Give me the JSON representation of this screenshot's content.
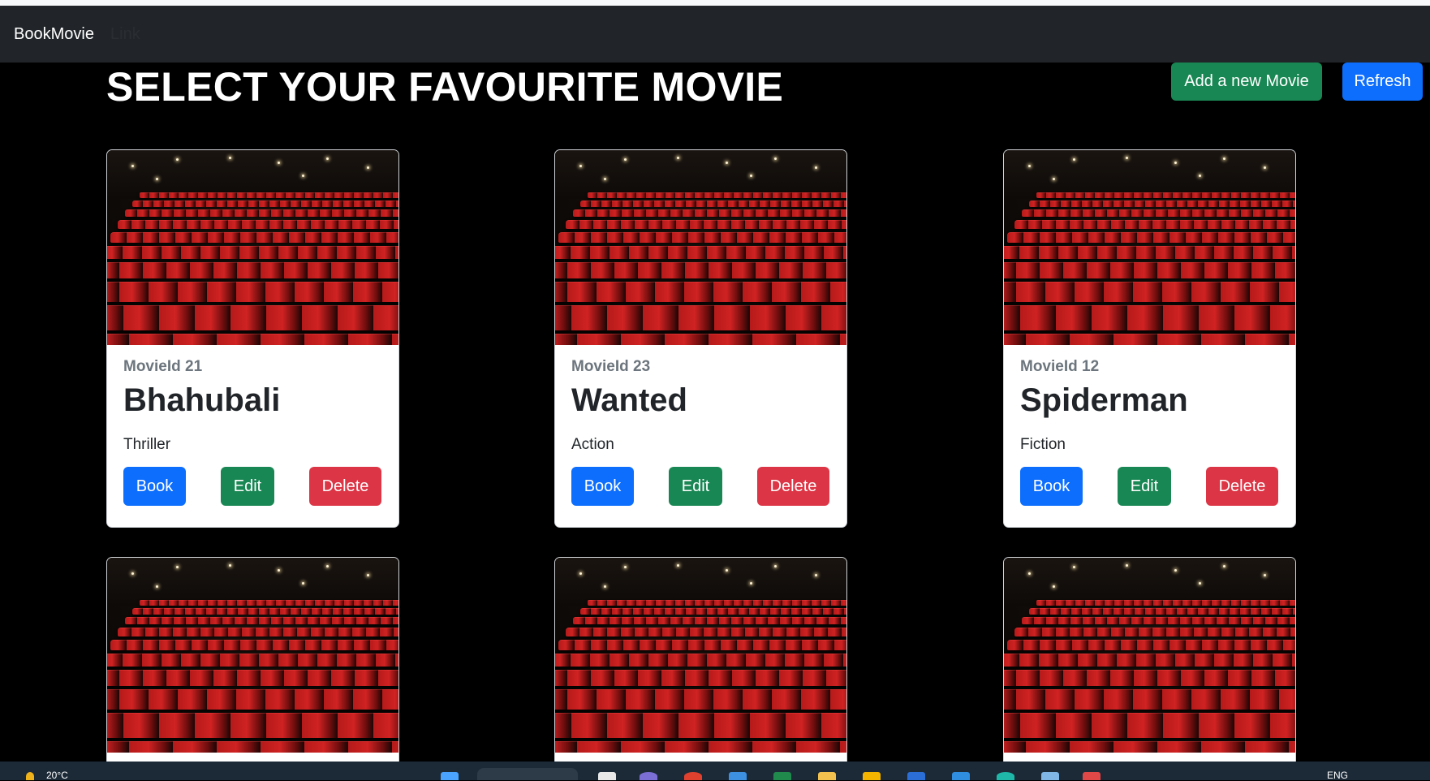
{
  "navbar": {
    "brand": "BookMovie",
    "link": "Link"
  },
  "page": {
    "title": "SELECT YOUR FAVOURITE MOVIE",
    "add_button": "Add a new Movie",
    "refresh_button": "Refresh"
  },
  "cards": [
    {
      "id_label": "MovieId 21",
      "title": "Bhahubali",
      "genre": "Thriller",
      "book": "Book",
      "edit": "Edit",
      "delete": "Delete"
    },
    {
      "id_label": "MovieId 23",
      "title": "Wanted",
      "genre": "Action",
      "book": "Book",
      "edit": "Edit",
      "delete": "Delete"
    },
    {
      "id_label": "MovieId 12",
      "title": "Spiderman",
      "genre": "Fiction",
      "book": "Book",
      "edit": "Edit",
      "delete": "Delete"
    }
  ],
  "taskbar": {
    "temperature": "20°C",
    "language": "ENG"
  },
  "colors": {
    "navbar": "#212529",
    "primary": "#0d6efd",
    "success": "#198754",
    "danger": "#dc3545"
  }
}
